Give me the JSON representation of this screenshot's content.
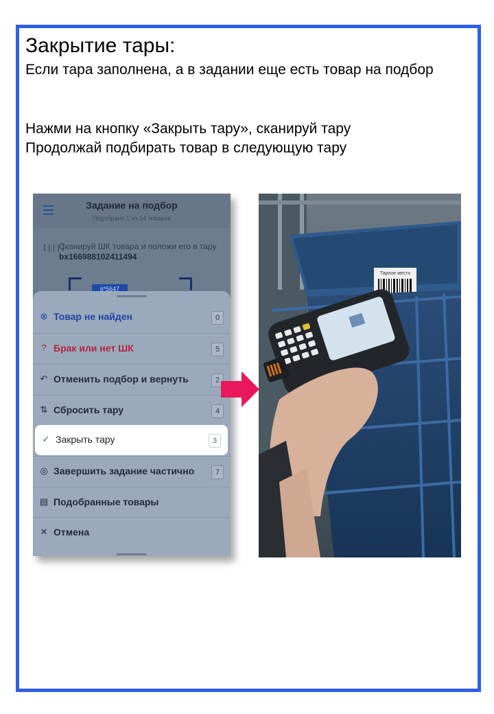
{
  "slide": {
    "title": "Закрытие тары:",
    "line1": "Если тара заполнена,  а в задании еще есть товар на подбор",
    "line2": "Нажми на кнопку «Закрыть тару», сканируй тару",
    "line3": "Продолжай  подбирать товар в следующую тару"
  },
  "phone": {
    "header": {
      "title": "Задание на подбор",
      "subtitle": "Подобрано 1 из 14 товаров"
    },
    "scan": {
      "text_prefix": "Сканируй ШК товара и положи его в тару ",
      "container_id": "bx166988102411494",
      "badge": "it*5647"
    },
    "menu": [
      {
        "label": "Товар не найден",
        "badge": "0",
        "icon": "circle-x-icon"
      },
      {
        "label": "Брак или нет ШК",
        "badge": "5",
        "icon": "circle-question-icon"
      },
      {
        "label": "Отменить подбор и вернуть",
        "badge": "2",
        "icon": "undo-icon"
      },
      {
        "label": "Сбросить тару",
        "badge": "4",
        "icon": "reset-container-icon"
      },
      {
        "label": "Закрыть тару",
        "badge": "3",
        "icon": "check-icon"
      },
      {
        "label": "Завершить задание частично",
        "badge": "7",
        "icon": "circle-check-icon"
      },
      {
        "label": "Подобранные товары",
        "badge": "",
        "icon": "document-icon"
      },
      {
        "label": "Отмена",
        "badge": "",
        "icon": "close-icon"
      }
    ]
  },
  "photo": {
    "label_on_box": "Тарное место"
  },
  "colors": {
    "border": "#2f5fe6",
    "arrow": "#e8185a"
  }
}
